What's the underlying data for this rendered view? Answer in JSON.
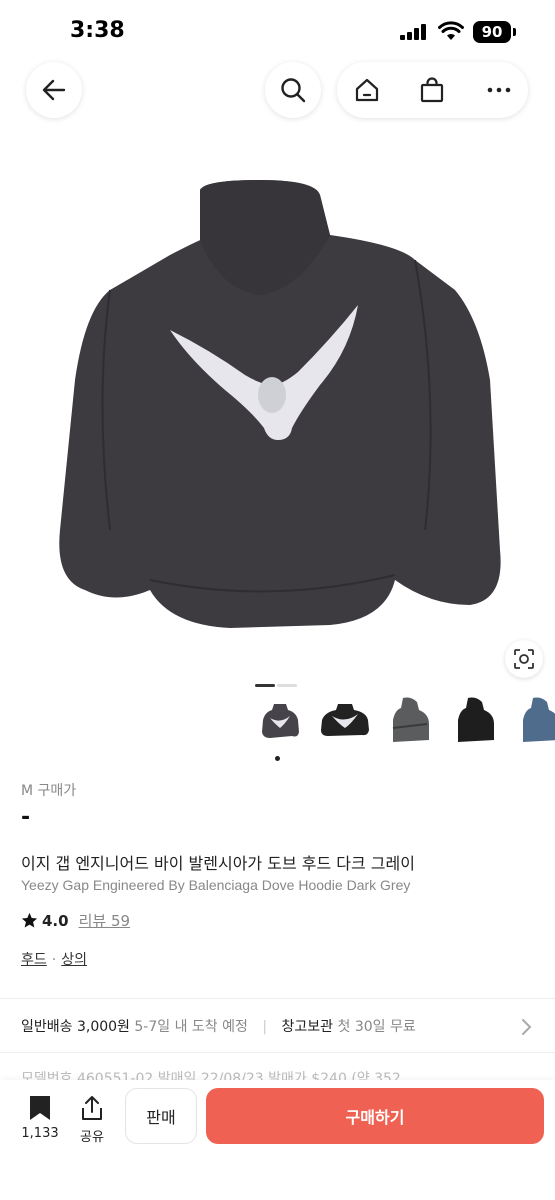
{
  "status_bar": {
    "time": "3:38",
    "battery": "90"
  },
  "nav": {
    "back_icon": "arrow-left-icon",
    "search_icon": "search-icon",
    "home_icon": "home-icon",
    "bag_icon": "shopping-bag-icon",
    "more_icon": "more-icon"
  },
  "product": {
    "size_price_label": "M 구매가",
    "price": "-",
    "name_ko": "이지 갭 엔지니어드 바이 발렌시아가 도브 후드 다크 그레이",
    "name_en": "Yeezy Gap Engineered By Balenciaga Dove Hoodie Dark Grey",
    "rating": "4.0",
    "review_label": "리뷰 59",
    "categories": [
      "후드",
      "상의"
    ],
    "category_sep": "·"
  },
  "shipping": {
    "standard_label": "일반배송 3,000원",
    "standard_eta": "5-7일 내 도착 예정",
    "warehouse_label": "창고보관",
    "warehouse_note": "첫 30일 무료"
  },
  "meta_row_partial": "모델번호 460551-02   발매일 22/08/23   발매가 $240 (약 352,",
  "bottom_bar": {
    "wishlist_count": "1,133",
    "share_label": "공유",
    "sell_label": "판매",
    "buy_label": "구매하기"
  },
  "colors": {
    "buy_button": "#ef6253",
    "hoodie": "#3d3a40"
  },
  "thumbnails": [
    "dark-grey-back",
    "black-back",
    "grey-side",
    "black-side",
    "blue-side"
  ]
}
